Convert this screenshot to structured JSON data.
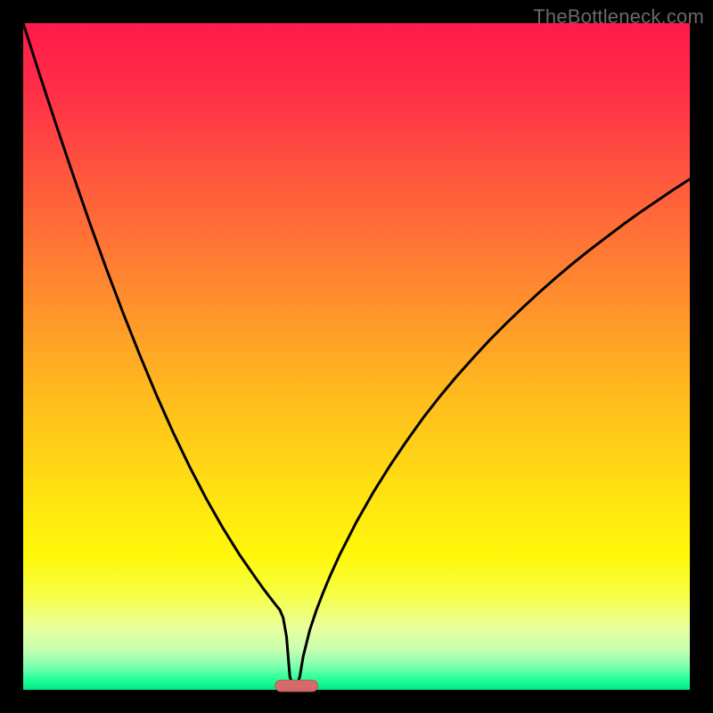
{
  "watermark": "TheBottleneck.com",
  "colors": {
    "frame": "#000000",
    "curve": "#000000",
    "marker_fill": "#d46a6a",
    "marker_stroke": "#c05858",
    "gradient_stops": [
      {
        "offset": 0.0,
        "color": "#ff1a4b"
      },
      {
        "offset": 0.1,
        "color": "#ff2e48"
      },
      {
        "offset": 0.24,
        "color": "#ff5a3c"
      },
      {
        "offset": 0.4,
        "color": "#ff8a2f"
      },
      {
        "offset": 0.55,
        "color": "#ffb91f"
      },
      {
        "offset": 0.7,
        "color": "#ffe012"
      },
      {
        "offset": 0.8,
        "color": "#fff80a"
      },
      {
        "offset": 0.86,
        "color": "#f6ff4a"
      },
      {
        "offset": 0.905,
        "color": "#eaff9a"
      },
      {
        "offset": 0.94,
        "color": "#c7ffb0"
      },
      {
        "offset": 0.965,
        "color": "#7dffb0"
      },
      {
        "offset": 0.985,
        "color": "#20ff98"
      },
      {
        "offset": 1.0,
        "color": "#00e884"
      }
    ]
  },
  "layout": {
    "outer_w": 800,
    "outer_h": 800,
    "inner_x": 26,
    "inner_y": 26,
    "inner_w": 748,
    "inner_h": 748
  },
  "chart_data": {
    "type": "line",
    "title": "",
    "xlabel": "",
    "ylabel": "",
    "xlim": [
      0,
      100
    ],
    "ylim": [
      0,
      100
    ],
    "x": [
      0,
      2.5,
      5,
      7.5,
      10,
      12.5,
      15,
      17.5,
      20,
      22.5,
      25,
      27.5,
      30,
      32.5,
      35,
      36,
      37,
      38,
      38.5,
      39,
      39.5,
      40,
      40.5,
      41,
      41.5,
      42,
      43,
      44,
      45,
      46,
      47.5,
      50,
      52.5,
      55,
      57.5,
      60,
      62.5,
      65,
      67.5,
      70,
      72.5,
      75,
      77.5,
      80,
      82.5,
      85,
      87.5,
      90,
      92.5,
      95,
      97.5,
      100
    ],
    "values": [
      100,
      92.2,
      84.6,
      77.2,
      70.0,
      63.1,
      56.5,
      50.2,
      44.2,
      38.6,
      33.4,
      28.6,
      24.2,
      20.2,
      16.6,
      15.2,
      13.9,
      12.6,
      12.0,
      10.8,
      8.0,
      2.0,
      0.5,
      0.5,
      2.0,
      5.0,
      9.0,
      12.0,
      14.6,
      17.0,
      20.3,
      25.2,
      29.6,
      33.6,
      37.3,
      40.8,
      44.0,
      47.0,
      49.8,
      52.5,
      55.0,
      57.4,
      59.7,
      61.9,
      64.0,
      66.0,
      67.9,
      69.8,
      71.6,
      73.3,
      75.0,
      76.6
    ],
    "marker": {
      "x_center": 41.0,
      "y": 0.6,
      "half_width": 3.2,
      "height": 1.7
    }
  }
}
